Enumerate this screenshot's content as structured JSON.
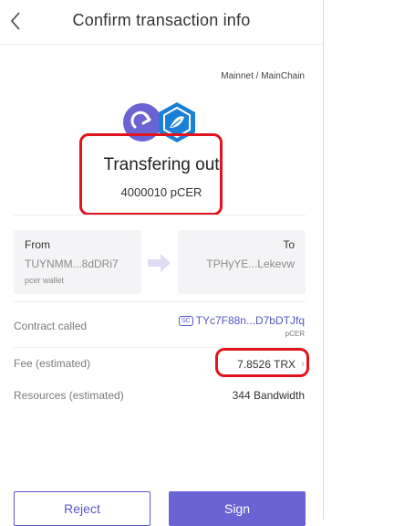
{
  "header": {
    "title": "Confirm transaction info"
  },
  "network": "Mainnet / MainChain",
  "transfer": {
    "title": "Transfering out",
    "amount": "4000010 pCER"
  },
  "from": {
    "label": "From",
    "address": "TUYNMM...8dDRi7",
    "wallet": "pcer wallet"
  },
  "to": {
    "label": "To",
    "address": "TPHyYE...Lekevw"
  },
  "contract": {
    "label": "Contract called",
    "badge": "SC",
    "address": "TYc7F88n...D7bDTJfq",
    "token": "pCER"
  },
  "fee": {
    "label": "Fee (estimated)",
    "value": "7.8526 TRX"
  },
  "resources": {
    "label": "Resources (estimated)",
    "value": "344 Bandwidth"
  },
  "buttons": {
    "reject": "Reject",
    "sign": "Sign"
  },
  "colors": {
    "accent": "#6a63d4",
    "highlight": "#e0141e",
    "icon_purple": "#6b63d3",
    "icon_blue": "#1a7fd6"
  }
}
